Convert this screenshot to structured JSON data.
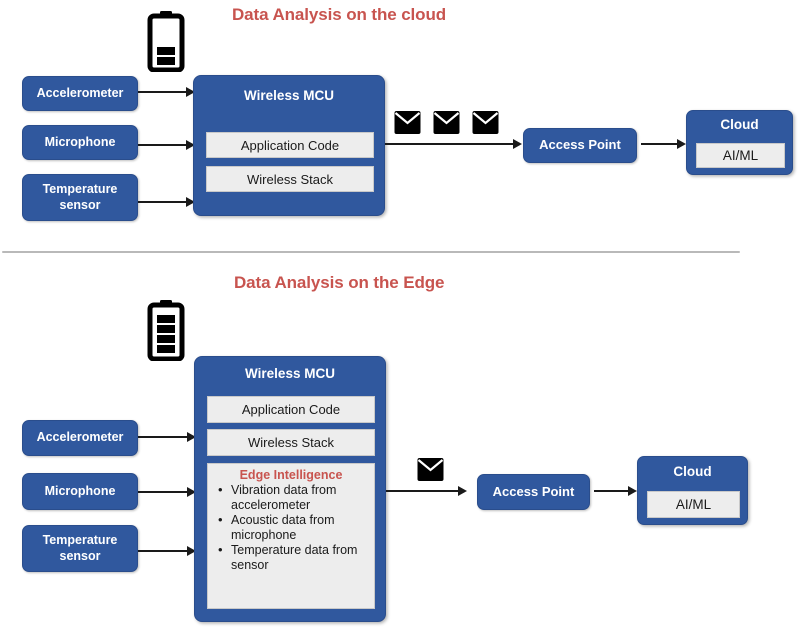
{
  "meta": {
    "accent_blue": "#30589E",
    "accent_red": "#C8544F",
    "slot_gray": "#EDEDED"
  },
  "cloud_section": {
    "title": "Data Analysis on the cloud",
    "battery": {
      "icon": "battery-low-icon",
      "bars_filled": 2,
      "bars_total": 4
    },
    "sensors": [
      {
        "label": "Accelerometer"
      },
      {
        "label": "Microphone"
      },
      {
        "label": "Temperature sensor"
      }
    ],
    "mcu": {
      "title": "Wireless MCU",
      "slots": [
        {
          "label": "Application Code"
        },
        {
          "label": "Wireless Stack"
        }
      ]
    },
    "messages": [
      {
        "icon": "envelope-icon"
      },
      {
        "icon": "envelope-icon"
      },
      {
        "icon": "envelope-icon"
      }
    ],
    "access_point": {
      "label": "Access Point"
    },
    "cloud": {
      "title": "Cloud",
      "slot": "AI/ML"
    }
  },
  "edge_section": {
    "title": "Data Analysis on the Edge",
    "battery": {
      "icon": "battery-full-icon",
      "bars_filled": 4,
      "bars_total": 4
    },
    "sensors": [
      {
        "label": "Accelerometer"
      },
      {
        "label": "Microphone"
      },
      {
        "label": "Temperature sensor"
      }
    ],
    "mcu": {
      "title": "Wireless MCU",
      "slots": [
        {
          "label": "Application Code"
        },
        {
          "label": "Wireless Stack"
        }
      ],
      "edge_panel": {
        "title": "Edge Intelligence",
        "items": [
          "Vibration data from accelerometer",
          "Acoustic data from microphone",
          "Temperature data from sensor"
        ]
      }
    },
    "messages": [
      {
        "icon": "envelope-icon"
      }
    ],
    "access_point": {
      "label": "Access Point"
    },
    "cloud": {
      "title": "Cloud",
      "slot": "AI/ML"
    }
  }
}
